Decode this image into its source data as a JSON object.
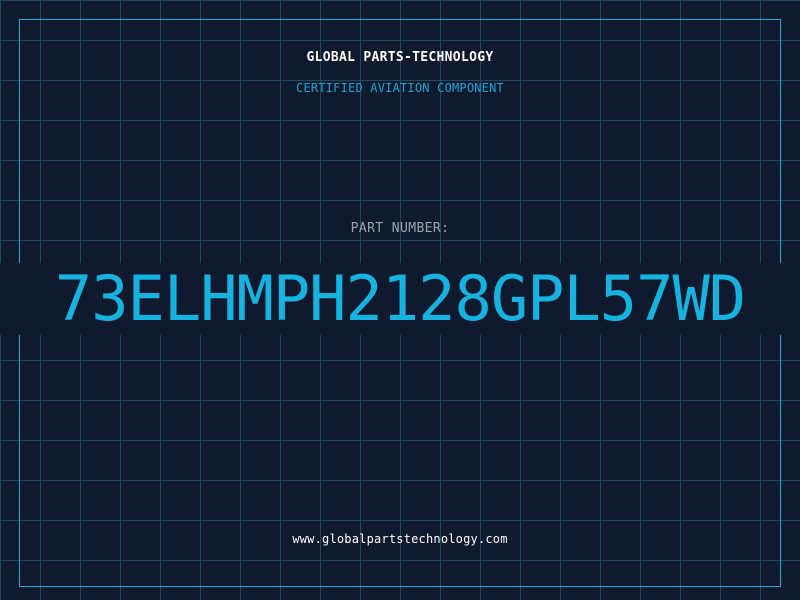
{
  "header": {
    "company": "GLOBAL PARTS-TECHNOLOGY",
    "tagline": "CERTIFIED AVIATION COMPONENT"
  },
  "part": {
    "label": "PART NUMBER:",
    "number": "73ELHMPH2128GPL57WD"
  },
  "footer": {
    "website": "www.globalpartstechnology.com"
  },
  "colors": {
    "background": "#101a2e",
    "grid": "#1c4a5e",
    "accent": "#16b3e0",
    "text": "#ffffff",
    "muted": "#9aa5b4"
  }
}
